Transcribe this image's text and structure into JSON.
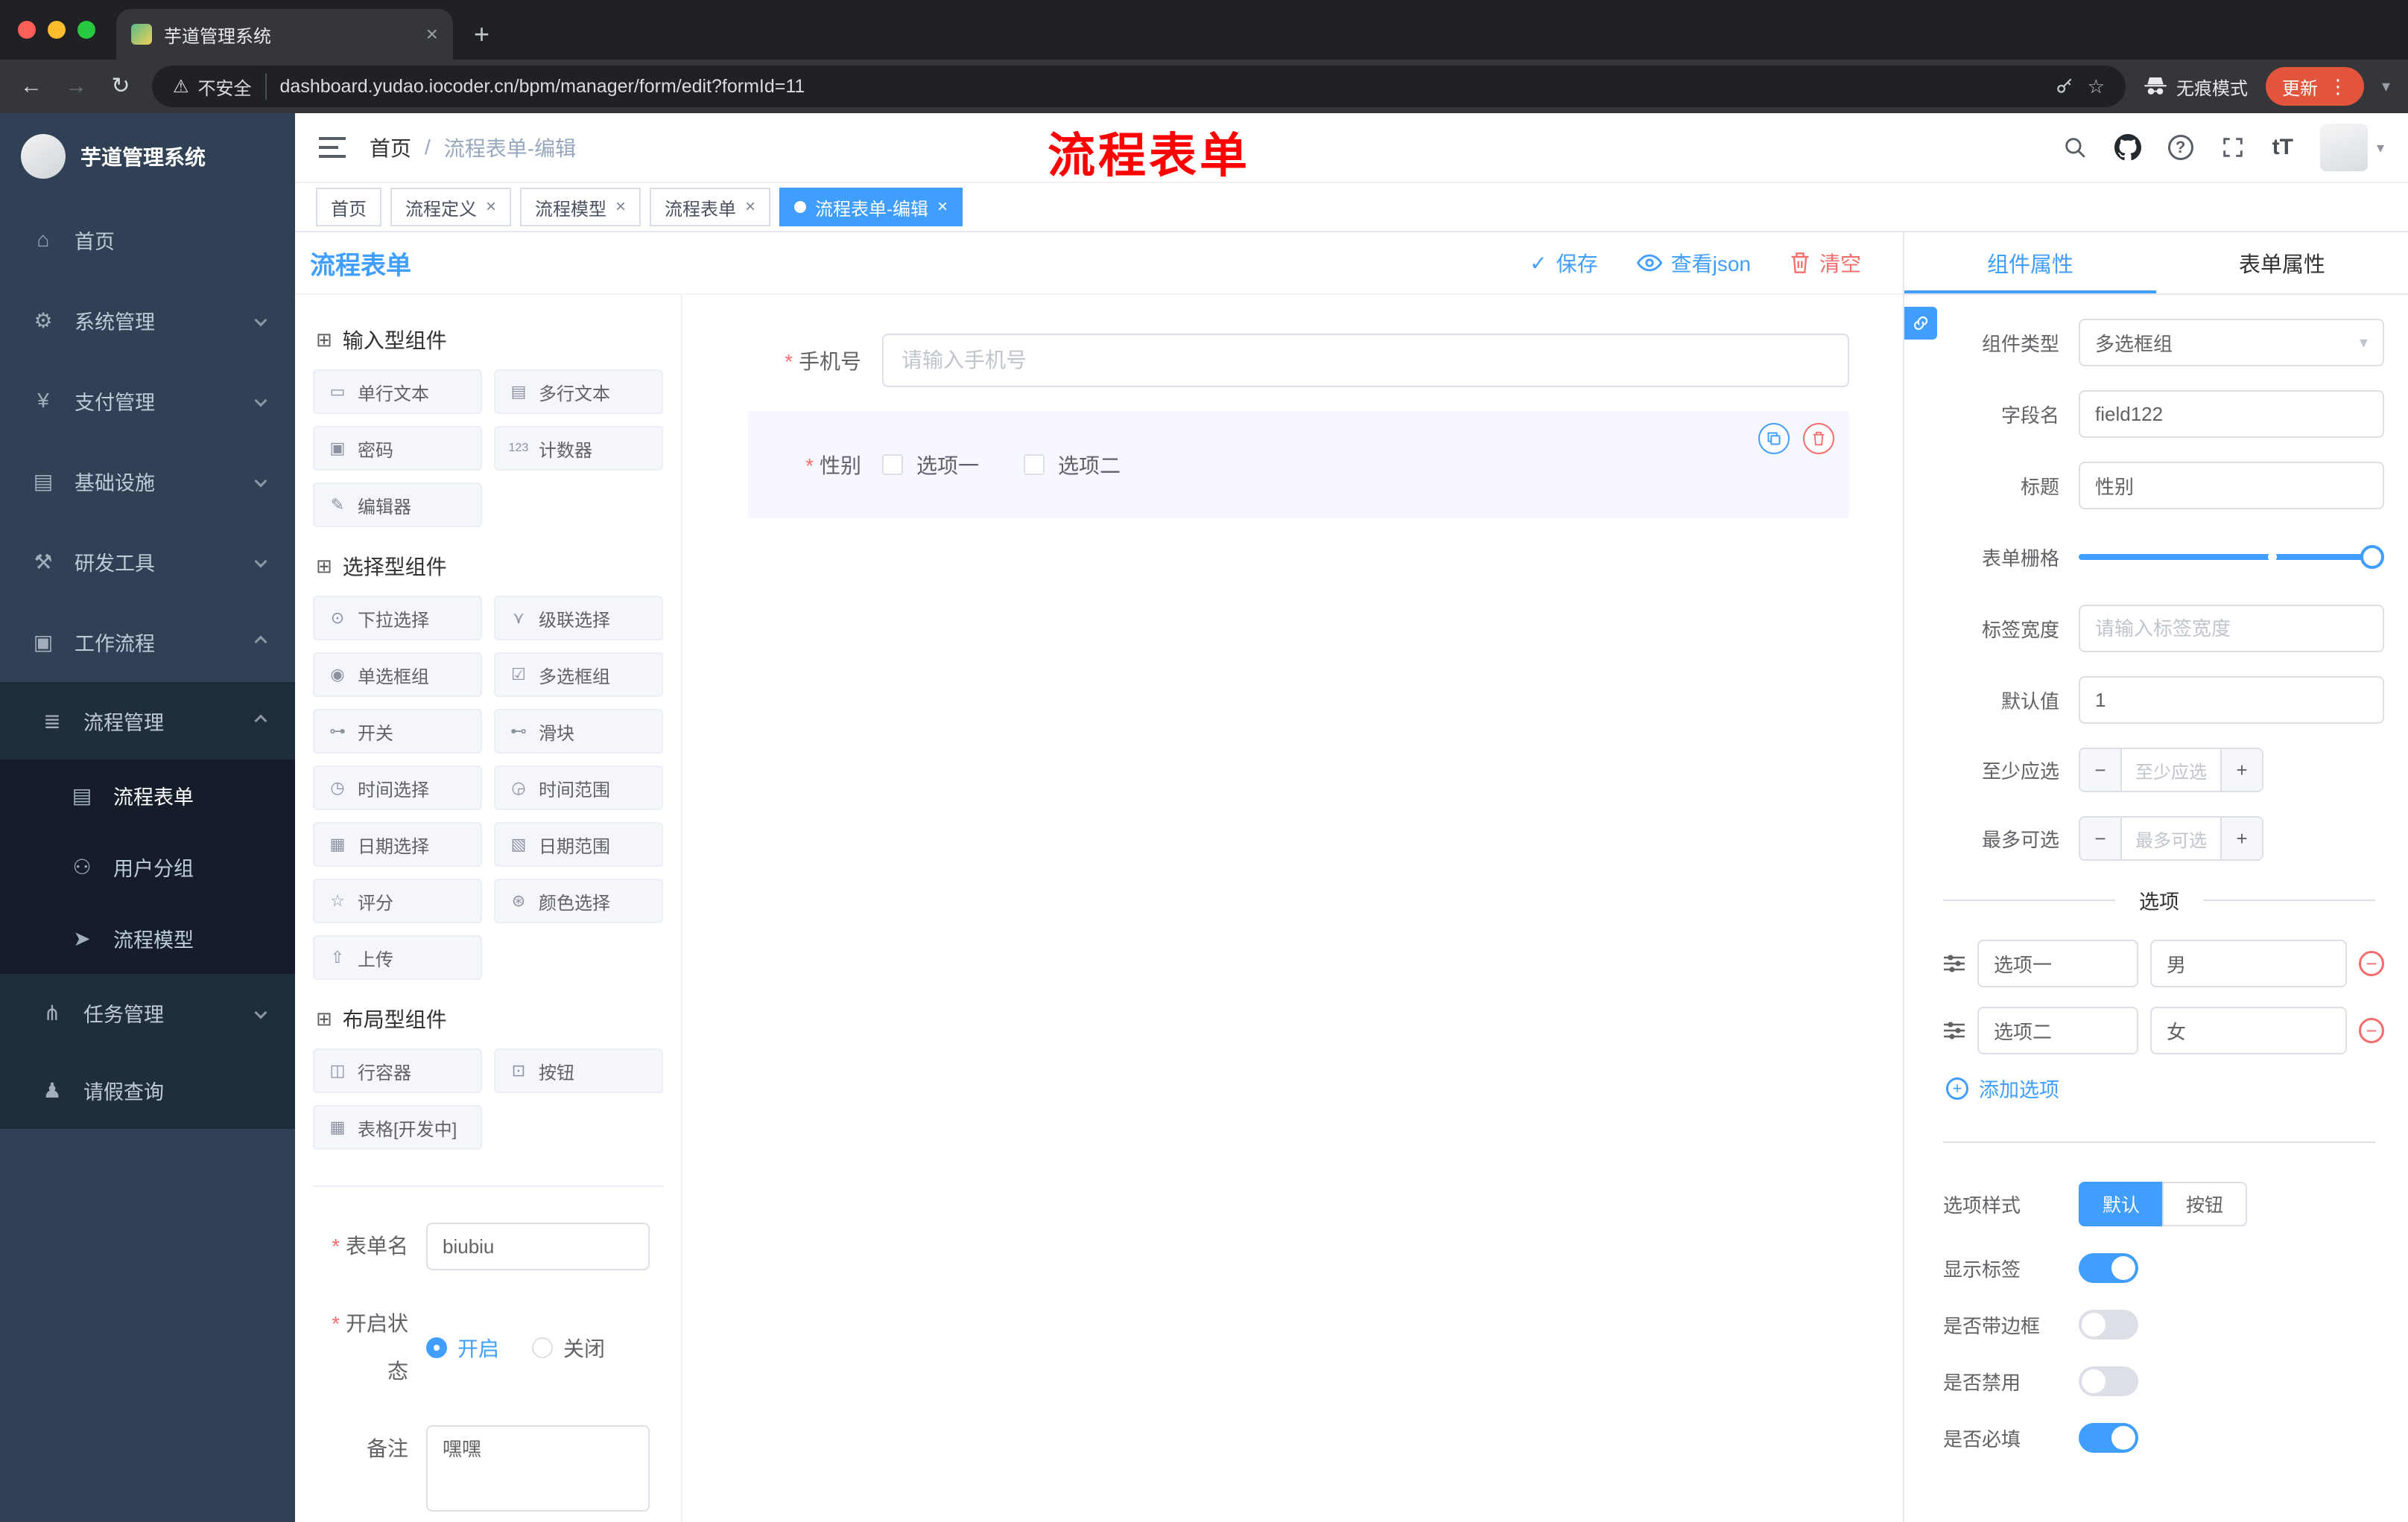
{
  "browser": {
    "tab_title": "芋道管理系统",
    "security": "不安全",
    "url": "dashboard.yudao.iocoder.cn/bpm/manager/form/edit?formId=11",
    "incognito": "无痕模式",
    "update": "更新"
  },
  "glyphs": {
    "back": "←",
    "forward": "→",
    "reload": "↻",
    "warning": "⚠",
    "star": "☆",
    "more": "⋮",
    "caret": "▾",
    "new_tab": "+",
    "close": "×",
    "help": "?",
    "fontsize": "tT",
    "check": "✓",
    "minus": "−",
    "plus": "+"
  },
  "sidebar": {
    "title": "芋道管理系统",
    "items": [
      {
        "label": "首页",
        "icon": "⌂"
      },
      {
        "label": "系统管理",
        "icon": "⚙"
      },
      {
        "label": "支付管理",
        "icon": "¥"
      },
      {
        "label": "基础设施",
        "icon": "▤"
      },
      {
        "label": "研发工具",
        "icon": "⚒"
      },
      {
        "label": "工作流程",
        "icon": "▣"
      },
      {
        "label": "流程管理",
        "icon": "≣"
      },
      {
        "label": "流程表单",
        "icon": "▤"
      },
      {
        "label": "用户分组",
        "icon": "⚇"
      },
      {
        "label": "流程模型",
        "icon": "➤"
      },
      {
        "label": "任务管理",
        "icon": "⋔"
      },
      {
        "label": "请假查询",
        "icon": "♟"
      }
    ]
  },
  "header": {
    "breadcrumb_home": "首页",
    "breadcrumb_sep": "/",
    "breadcrumb_current": "流程表单-编辑",
    "annotation": "流程表单"
  },
  "tags": [
    {
      "label": "首页"
    },
    {
      "label": "流程定义"
    },
    {
      "label": "流程模型"
    },
    {
      "label": "流程表单"
    },
    {
      "label": "流程表单-编辑"
    }
  ],
  "toolbar": {
    "title": "流程表单",
    "save": "保存",
    "view_json": "查看json",
    "clear": "清空"
  },
  "palette": [
    {
      "icon": "⊞",
      "title": "输入型组件",
      "items": [
        {
          "icon": "▭",
          "label": "单行文本"
        },
        {
          "icon": "▤",
          "label": "多行文本"
        },
        {
          "icon": "▣",
          "label": "密码"
        },
        {
          "icon": "123",
          "label": "计数器"
        },
        {
          "icon": "✎",
          "label": "编辑器"
        }
      ]
    },
    {
      "icon": "⊞",
      "title": "选择型组件",
      "items": [
        {
          "icon": "⊙",
          "label": "下拉选择"
        },
        {
          "icon": "⋎",
          "label": "级联选择"
        },
        {
          "icon": "◉",
          "label": "单选框组"
        },
        {
          "icon": "☑",
          "label": "多选框组"
        },
        {
          "icon": "⊶",
          "label": "开关"
        },
        {
          "icon": "⊷",
          "label": "滑块"
        },
        {
          "icon": "◷",
          "label": "时间选择"
        },
        {
          "icon": "◶",
          "label": "时间范围"
        },
        {
          "icon": "▦",
          "label": "日期选择"
        },
        {
          "icon": "▧",
          "label": "日期范围"
        },
        {
          "icon": "☆",
          "label": "评分"
        },
        {
          "icon": "⊛",
          "label": "颜色选择"
        },
        {
          "icon": "⇧",
          "label": "上传"
        }
      ]
    },
    {
      "icon": "⊞",
      "title": "布局型组件",
      "items": [
        {
          "icon": "◫",
          "label": "行容器"
        },
        {
          "icon": "⊡",
          "label": "按钮"
        },
        {
          "icon": "▦",
          "label": "表格[开发中]"
        }
      ]
    }
  ],
  "meta": {
    "form_name_label": "表单名",
    "form_name_value": "biubiu",
    "status_label": "开启状态",
    "status_on": "开启",
    "status_off": "关闭",
    "remark_label": "备注",
    "remark_value": "嘿嘿"
  },
  "canvas": {
    "phone_label": "手机号",
    "phone_placeholder": "请输入手机号",
    "gender_label": "性别",
    "gender_opt1": "选项一",
    "gender_opt2": "选项二"
  },
  "props": {
    "tab_component": "组件属性",
    "tab_form": "表单属性",
    "component_type_label": "组件类型",
    "component_type_value": "多选框组",
    "field_label": "字段名",
    "field_value": "field122",
    "title_label": "标题",
    "title_value": "性别",
    "grid_label": "表单栅格",
    "label_width_label": "标签宽度",
    "label_width_placeholder": "请输入标签宽度",
    "default_label": "默认值",
    "default_value": "1",
    "min_label": "至少应选",
    "min_placeholder": "至少应选",
    "max_label": "最多可选",
    "max_placeholder": "最多可选",
    "options_title": "选项",
    "options": [
      {
        "label": "选项一",
        "value": "男"
      },
      {
        "label": "选项二",
        "value": "女"
      }
    ],
    "add_option": "添加选项",
    "option_style_label": "选项样式",
    "style_default": "默认",
    "style_button": "按钮",
    "toggle_show_label": "显示标签",
    "toggle_border": "是否带边框",
    "toggle_disabled": "是否禁用",
    "toggle_required": "是否必填"
  }
}
